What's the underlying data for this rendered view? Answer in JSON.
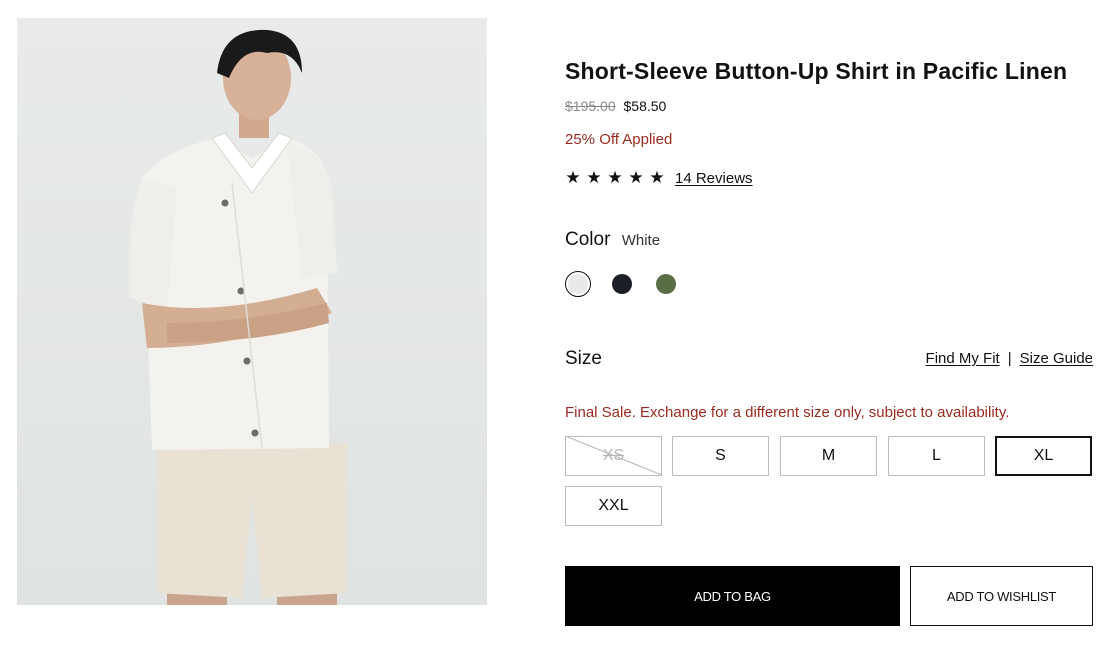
{
  "product": {
    "title": "Short-Sleeve Button-Up Shirt in Pacific Linen",
    "price_original": "$195.00",
    "price_sale": "$58.50",
    "discount_text": "25% Off Applied",
    "rating": {
      "stars": 5,
      "star_glyph": "★",
      "reviews_label": "14 Reviews"
    }
  },
  "color": {
    "label": "Color",
    "selected_name": "White",
    "swatches": [
      {
        "name": "white",
        "hex": "#e9e9e9",
        "selected": true
      },
      {
        "name": "black",
        "hex": "#1c1f26",
        "selected": false
      },
      {
        "name": "olive",
        "hex": "#5a6e46",
        "selected": false
      }
    ]
  },
  "size": {
    "label": "Size",
    "find_fit_label": "Find My Fit",
    "separator": "|",
    "guide_label": "Size Guide",
    "final_sale_text": "Final Sale. Exchange for a different size only, subject to availability.",
    "options": [
      {
        "label": "XS",
        "available": false,
        "selected": false
      },
      {
        "label": "S",
        "available": true,
        "selected": false
      },
      {
        "label": "M",
        "available": true,
        "selected": false
      },
      {
        "label": "L",
        "available": true,
        "selected": false
      },
      {
        "label": "XL",
        "available": true,
        "selected": true
      },
      {
        "label": "XXL",
        "available": true,
        "selected": false
      }
    ]
  },
  "actions": {
    "add_to_bag": "ADD TO BAG",
    "add_to_wishlist": "ADD TO WISHLIST"
  },
  "colors": {
    "sale_red": "#9b2b20",
    "primary_black": "#000000"
  }
}
